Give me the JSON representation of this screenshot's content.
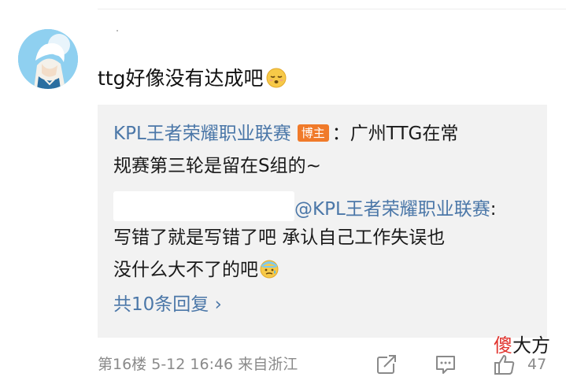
{
  "comment": {
    "text": "ttg好像没有达成吧",
    "emoji": "sleepy-face-emoji"
  },
  "reply": {
    "author": "KPL王者荣耀职业联赛",
    "badge": "博主",
    "line1_rest": "：广州TTG在常",
    "line2": "规赛第三轮是留在S组的~",
    "mention": "@KPL王者荣耀职业联赛",
    "mention_colon": ":",
    "line4": "写错了就是写错了吧 承认自己工作失误也",
    "line5": "没什么大不了的吧",
    "emoji": "cold-sweat-emoji",
    "more_label": "共10条回复 ›"
  },
  "footer": {
    "floor": "第16楼",
    "time": "5-12 16:46",
    "location": "来自浙江",
    "like_count": "47"
  },
  "watermark": {
    "red": "傻",
    "black": "大方"
  },
  "colors": {
    "link": "#4b77a8",
    "badge": "#f07a2a",
    "meta": "#8a8a8a",
    "reply_bg": "#f2f2f2"
  }
}
